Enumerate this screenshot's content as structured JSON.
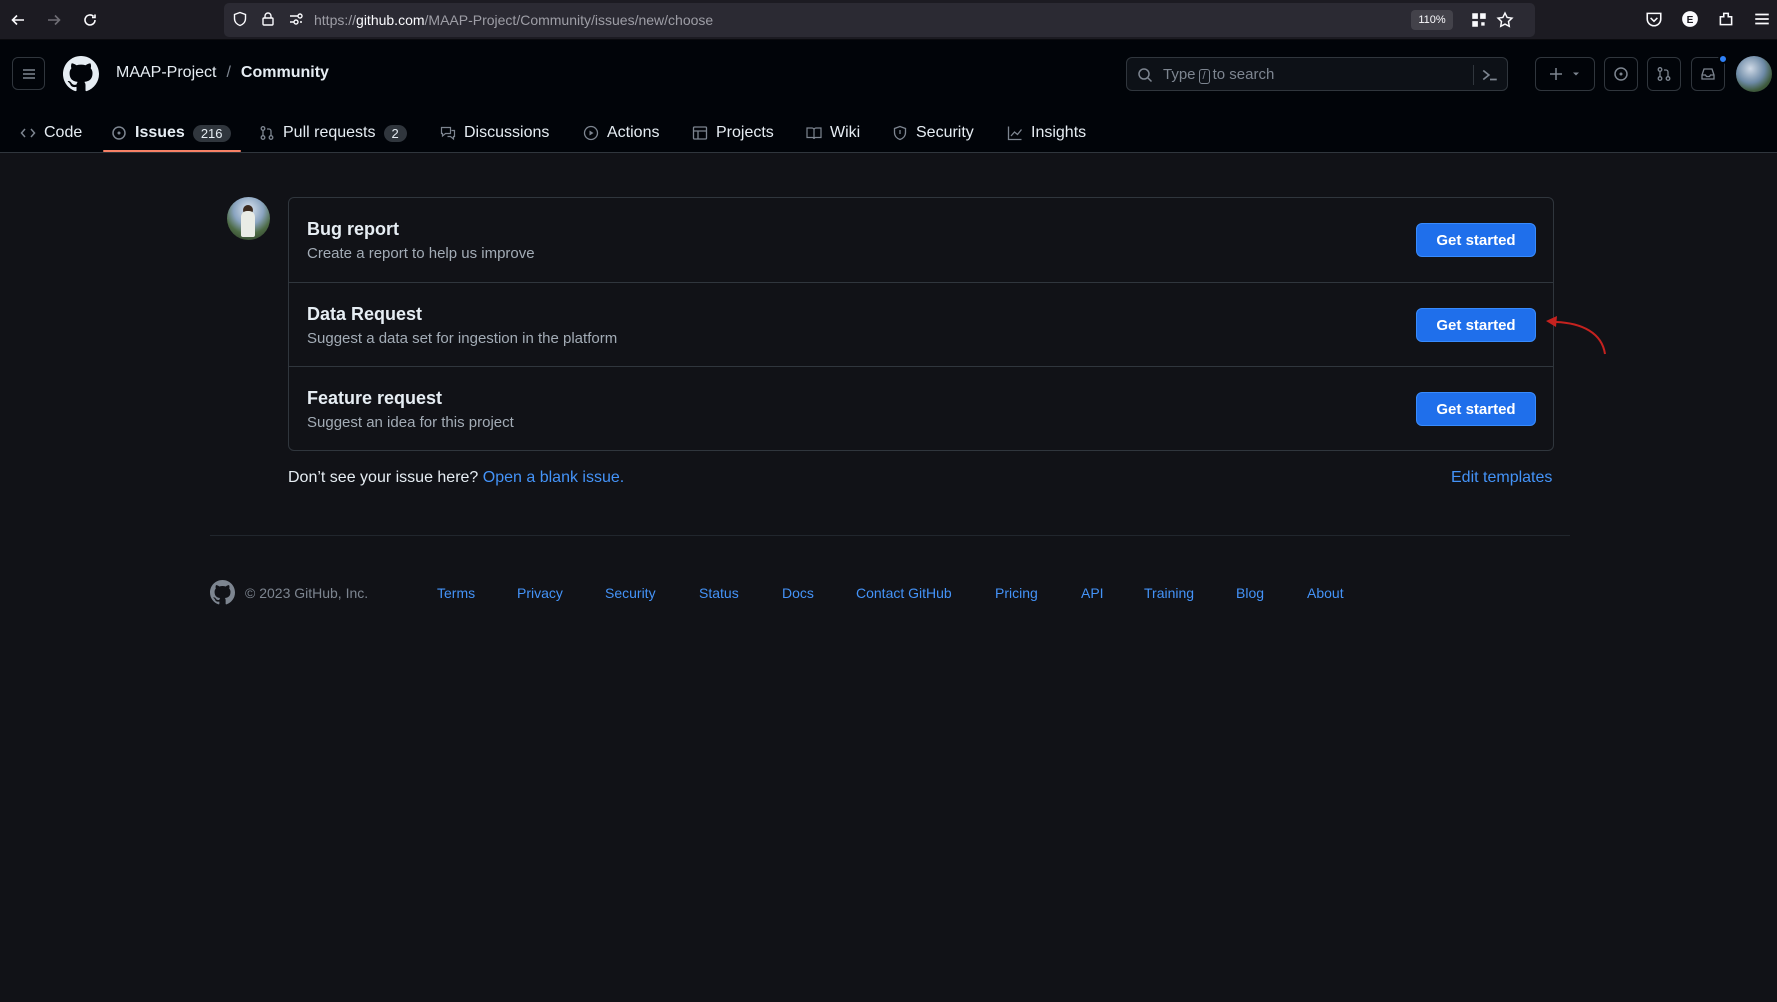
{
  "browser": {
    "url_prefix": "https://",
    "url_domain": "github.com",
    "url_path": "/MAAP-Project/Community/issues/new/choose",
    "zoom": "110%"
  },
  "header": {
    "owner": "MAAP-Project",
    "separator": "/",
    "repo": "Community",
    "search_prefix": "Type",
    "search_key": "/",
    "search_suffix": "to search"
  },
  "tabs": [
    {
      "label": "Code",
      "icon": "code-icon"
    },
    {
      "label": "Issues",
      "icon": "issue-opened-icon",
      "count": "216",
      "active": true
    },
    {
      "label": "Pull requests",
      "icon": "git-pull-request-icon",
      "count": "2"
    },
    {
      "label": "Discussions",
      "icon": "comment-discussion-icon"
    },
    {
      "label": "Actions",
      "icon": "play-icon"
    },
    {
      "label": "Projects",
      "icon": "table-icon"
    },
    {
      "label": "Wiki",
      "icon": "book-icon"
    },
    {
      "label": "Security",
      "icon": "shield-icon"
    },
    {
      "label": "Insights",
      "icon": "graph-icon"
    }
  ],
  "templates": [
    {
      "title": "Bug report",
      "description": "Create a report to help us improve",
      "button": "Get started"
    },
    {
      "title": "Data Request",
      "description": "Suggest a data set for ingestion in the platform",
      "button": "Get started"
    },
    {
      "title": "Feature request",
      "description": "Suggest an idea for this project",
      "button": "Get started"
    }
  ],
  "blank_issue": {
    "prompt": "Don’t see your issue here?",
    "link": "Open a blank issue."
  },
  "edit_templates": "Edit templates",
  "footer": {
    "copyright": "© 2023 GitHub, Inc.",
    "links": [
      "Terms",
      "Privacy",
      "Security",
      "Status",
      "Docs",
      "Contact GitHub",
      "Pricing",
      "API",
      "Training",
      "Blog",
      "About"
    ]
  },
  "colors": {
    "accent": "#1f6feb",
    "link": "#4493f8",
    "tab_underline": "#f78166",
    "annotation_arrow": "#c5221f"
  }
}
